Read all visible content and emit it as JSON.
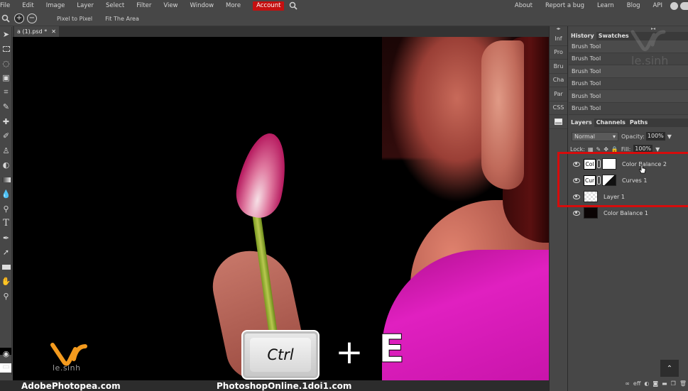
{
  "menu": {
    "items": [
      "File",
      "Edit",
      "Image",
      "Layer",
      "Select",
      "Filter",
      "View",
      "Window",
      "More"
    ],
    "account": "Account",
    "right_links": [
      "About",
      "Report a bug",
      "Learn",
      "Blog",
      "API"
    ]
  },
  "options": {
    "zoom_in": "+",
    "zoom_out": "−",
    "pixel_to_pixel": "Pixel to Pixel",
    "fit_area": "Fit The Area"
  },
  "document": {
    "tab_title": "a (1).psd *",
    "close": "✕"
  },
  "side_tabs": [
    "Inf",
    "Pro",
    "Bru",
    "Cha",
    "Par",
    "CSS"
  ],
  "history_panel": {
    "tabs": [
      "History",
      "Swatches"
    ],
    "items": [
      "Brush Tool",
      "Brush Tool",
      "Brush Tool",
      "Brush Tool",
      "Brush Tool",
      "Brush Tool"
    ]
  },
  "layers_panel": {
    "tabs": [
      "Layers",
      "Channels",
      "Paths"
    ],
    "blend_mode": "Normal",
    "opacity_label": "Opacity:",
    "opacity_value": "100%",
    "lock_label": "Lock:",
    "fill_label": "Fill:",
    "fill_value": "100%",
    "layers": [
      {
        "name": "Color Balance 2",
        "adj_label": "Col",
        "type": "adjustment"
      },
      {
        "name": "Curves 1",
        "adj_label": "Cur",
        "type": "adjustment"
      },
      {
        "name": "Layer 1",
        "type": "pixel"
      },
      {
        "name": "Color Balance 1",
        "type": "pixel"
      }
    ],
    "highlight_color": "#d60c0c"
  },
  "overlay": {
    "shortcut_key1": "Ctrl",
    "shortcut_plus": "+",
    "shortcut_key2": "E",
    "watermark_text": "le.sinh",
    "footer_left": "AdobePhotopea.com",
    "footer_right": "PhotoshopOnline.1doi1.com"
  },
  "colors": {
    "accent_account": "#c41010",
    "panel_bg": "#474747",
    "logo_orange": "#f39a1e"
  }
}
